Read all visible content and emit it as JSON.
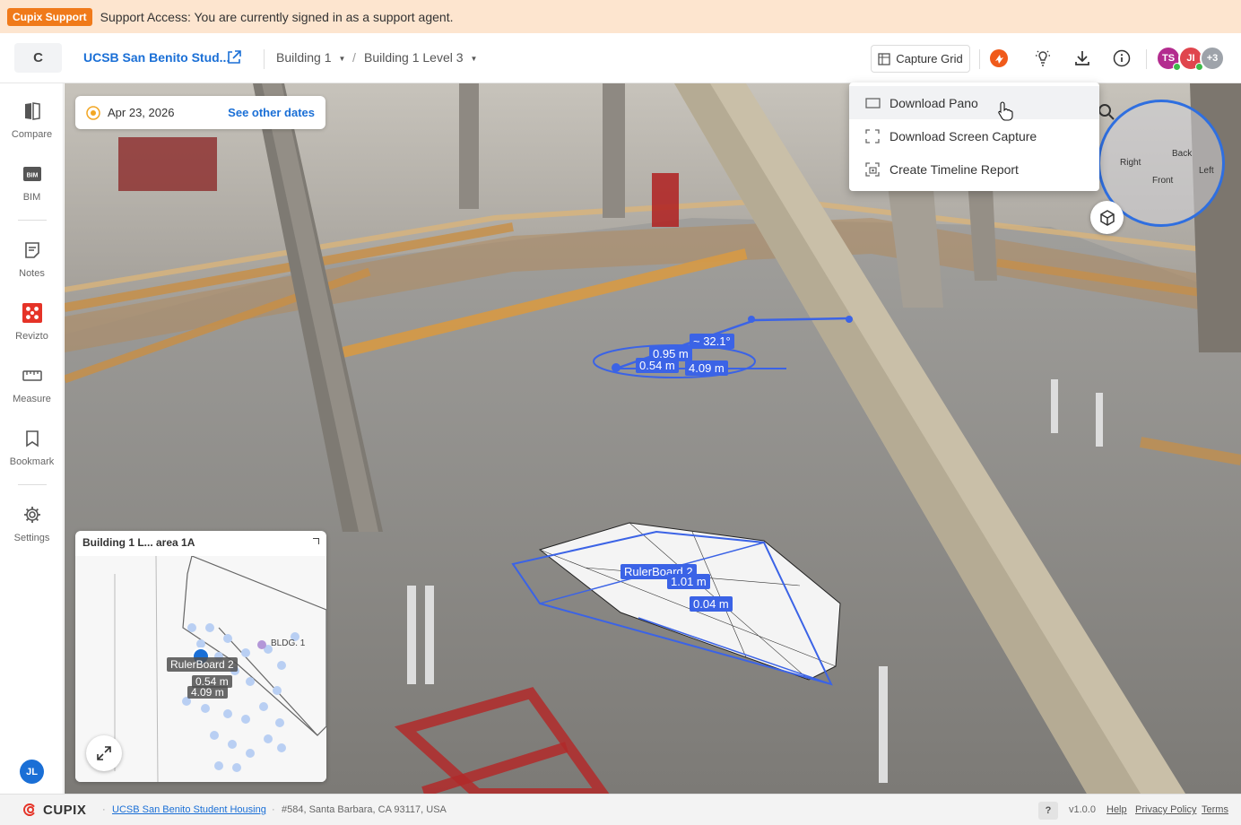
{
  "banner": {
    "tag": "Cupix Support",
    "message": "Support Access: You are currently signed in as a support agent."
  },
  "header": {
    "logo_letter": "C",
    "project_title": "UCSB San Benito Stud...",
    "breadcrumb": [
      {
        "label": "Building 1"
      },
      {
        "label": "Building 1 Level 3"
      }
    ],
    "breadcrumb_separator": "/",
    "capture_grid_label": "Capture Grid",
    "avatars": [
      {
        "initials": "TS",
        "color": "#b32c8f",
        "online": true
      },
      {
        "initials": "JI",
        "color": "#e0454d",
        "online": true
      },
      {
        "initials": "+3",
        "color": "#9ea3aa",
        "online": false
      }
    ]
  },
  "sidebar": {
    "items": [
      {
        "label": "Compare",
        "icon": "compare-icon"
      },
      {
        "label": "BIM",
        "icon": "bim-icon"
      },
      {
        "label": "Notes",
        "icon": "notes-icon"
      },
      {
        "label": "Revizto",
        "icon": "revizto-icon"
      },
      {
        "label": "Measure",
        "icon": "ruler-icon"
      },
      {
        "label": "Bookmark",
        "icon": "bookmark-icon"
      },
      {
        "label": "Settings",
        "icon": "gear-icon"
      }
    ],
    "user_initials": "JL"
  },
  "viewer": {
    "date": "Apr 23, 2026",
    "see_other_dates": "See other dates",
    "cube_labels": {
      "right": "Right",
      "back": "Back",
      "left": "Left",
      "front": "Front"
    },
    "measurements": {
      "angle": "~ 32.1°",
      "m1": "0.95 m",
      "m2": "0.54 m",
      "m3": "4.09 m",
      "board_label": "RulerBoard 2",
      "board_len": "1.01 m",
      "board_h": "0.04 m"
    }
  },
  "download_menu": {
    "items": [
      {
        "label": "Download Pano",
        "icon": "image-icon"
      },
      {
        "label": "Download Screen Capture",
        "icon": "screen-capture-icon"
      },
      {
        "label": "Create Timeline Report",
        "icon": "timeline-report-icon"
      }
    ]
  },
  "minimap": {
    "title": "Building 1 L... area 1A",
    "bldg_label": "BLDG. 1",
    "ruler_label": "RulerBoard 2",
    "m1": "0.54 m",
    "m2": "4.09 m"
  },
  "footer": {
    "brand": "CUPIX",
    "project_link": "UCSB San Benito Student Housing",
    "address": "#584, Santa Barbara, CA 93117, USA",
    "help_badge": "?",
    "version": "v1.0.0",
    "links": [
      "Help",
      "Privacy Policy",
      "Terms"
    ]
  },
  "colors": {
    "accent": "#1a6fd6",
    "banner_bg": "#fde5cf",
    "support_tag": "#f07a1a",
    "measure_blue": "#3b63e6"
  }
}
